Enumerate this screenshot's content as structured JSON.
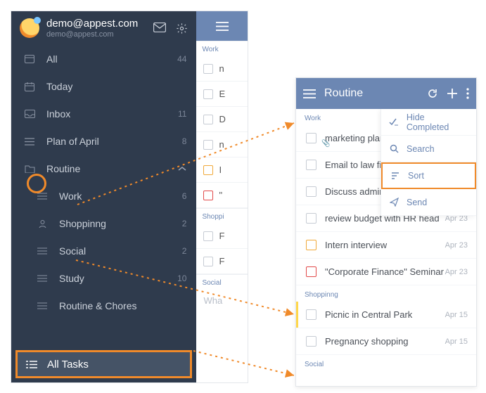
{
  "sidebar": {
    "email": "demo@appest.com",
    "email_sub": "demo@appest.com",
    "items": [
      {
        "label": "All",
        "count": "44"
      },
      {
        "label": "Today",
        "count": ""
      },
      {
        "label": "Inbox",
        "count": "11"
      },
      {
        "label": "Plan of April",
        "count": "8"
      },
      {
        "label": "Routine",
        "count": ""
      },
      {
        "label": "Work",
        "count": "6"
      },
      {
        "label": "Shoppinng",
        "count": "2"
      },
      {
        "label": "Social",
        "count": "2"
      },
      {
        "label": "Study",
        "count": "10"
      },
      {
        "label": "Routine & Chores",
        "count": ""
      }
    ],
    "all_tasks_label": "All Tasks"
  },
  "peek": {
    "sections": {
      "work": "Work",
      "shopping": "Shoppi",
      "social": "Social"
    },
    "rows": [
      "n",
      "E",
      "D",
      "n",
      "I",
      "\"",
      "F",
      "F",
      "Wha"
    ]
  },
  "routine": {
    "title": "Routine",
    "sections": {
      "work": "Work",
      "shopping": "Shoppinng",
      "social": "Social"
    },
    "tasks": [
      {
        "label": "marketing plan brain st",
        "date": "",
        "attach": true
      },
      {
        "label": "Email to law firm",
        "date": ""
      },
      {
        "label": "Discuss admin HC",
        "date": ""
      },
      {
        "label": "review budget with HR head",
        "date": "Apr 23"
      },
      {
        "label": "Intern interview",
        "date": "Apr 23",
        "org": true
      },
      {
        "label": "\"Corporate Finance\" Seminar",
        "date": "Apr 23",
        "red": true
      },
      {
        "label": "Picnic in Central Park",
        "date": "Apr 15",
        "ybar": true
      },
      {
        "label": "Pregnancy shopping",
        "date": "Apr 15"
      }
    ],
    "menu": {
      "hide_completed": "Hide Completed",
      "search": "Search",
      "sort": "Sort",
      "send": "Send"
    }
  }
}
